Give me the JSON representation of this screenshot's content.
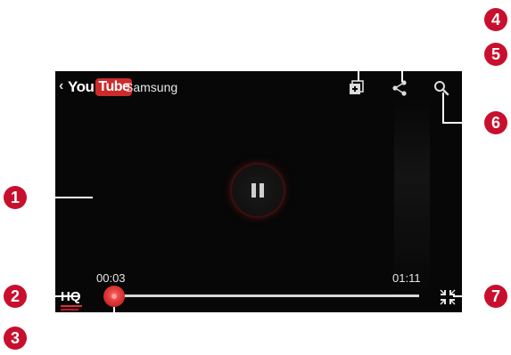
{
  "header": {
    "logo_you": "You",
    "logo_tube": "Tube",
    "channel": "Samsung"
  },
  "playback": {
    "elapsed": "00:03",
    "duration": "01:11",
    "progress": 0.04,
    "quality_label": "HQ"
  },
  "callouts": {
    "c1": "1",
    "c2": "2",
    "c3": "3",
    "c4": "4",
    "c5": "5",
    "c6": "6",
    "c7": "7"
  },
  "colors": {
    "accent": "#e03030",
    "callout": "#c8102e",
    "player_bg": "#070707"
  }
}
